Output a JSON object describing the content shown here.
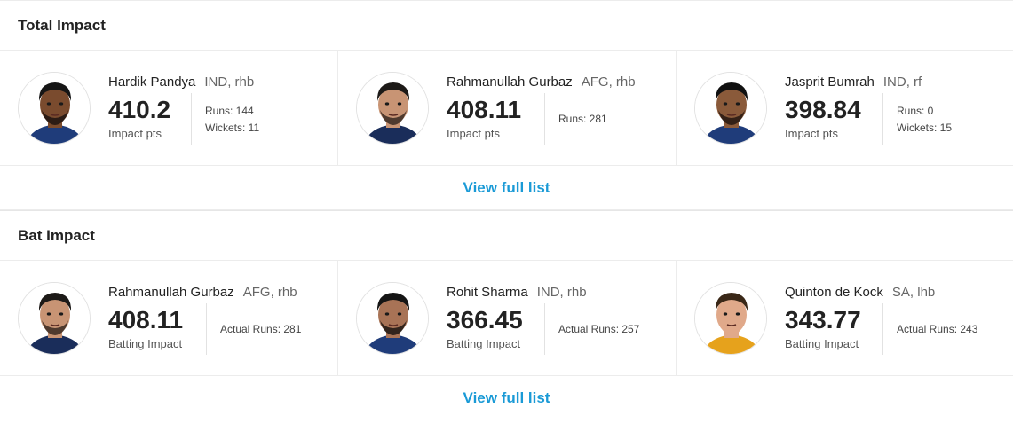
{
  "sections": [
    {
      "title": "Total Impact",
      "view_full": "View full list",
      "players": [
        {
          "name": "Hardik Pandya",
          "meta": "IND, rhb",
          "score": "410.2",
          "label": "Impact pts",
          "extra": [
            "Runs: 144",
            "Wickets: 11"
          ],
          "skin": "#7a4b2e",
          "hair": "#161616",
          "shirt": "#1f3c7a",
          "beard": "#1e1410"
        },
        {
          "name": "Rahmanullah Gurbaz",
          "meta": "AFG, rhb",
          "score": "408.11",
          "label": "Impact pts",
          "extra": [
            "Runs: 281"
          ],
          "skin": "#c89474",
          "hair": "#1d1a18",
          "shirt": "#1a2d5a",
          "beard": "#3a2a22"
        },
        {
          "name": "Jasprit Bumrah",
          "meta": "IND, rf",
          "score": "398.84",
          "label": "Impact pts",
          "extra": [
            "Runs: 0",
            "Wickets: 15"
          ],
          "skin": "#8a5a3a",
          "hair": "#111111",
          "shirt": "#1f3c7a",
          "beard": "#241812"
        }
      ]
    },
    {
      "title": "Bat Impact",
      "view_full": "View full list",
      "players": [
        {
          "name": "Rahmanullah Gurbaz",
          "meta": "AFG, rhb",
          "score": "408.11",
          "label": "Batting Impact",
          "extra": [
            "Actual Runs: 281"
          ],
          "skin": "#c89474",
          "hair": "#1d1a18",
          "shirt": "#1a2d5a",
          "beard": "#3a2a22"
        },
        {
          "name": "Rohit Sharma",
          "meta": "IND, rhb",
          "score": "366.45",
          "label": "Batting Impact",
          "extra": [
            "Actual Runs: 257"
          ],
          "skin": "#a87356",
          "hair": "#151515",
          "shirt": "#1f3c7a",
          "beard": "#1d1612"
        },
        {
          "name": "Quinton de Kock",
          "meta": "SA, lhb",
          "score": "343.77",
          "label": "Batting Impact",
          "extra": [
            "Actual Runs: 243"
          ],
          "skin": "#e0a98a",
          "hair": "#3a2818",
          "shirt": "#e6a21c",
          "beard": "#e0a98a"
        }
      ]
    }
  ]
}
